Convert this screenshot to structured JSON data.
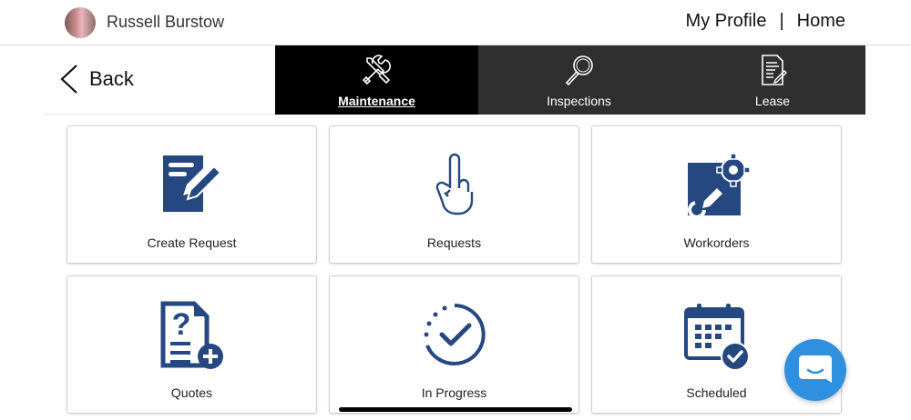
{
  "header": {
    "user_name": "Russell Burstow",
    "my_profile_label": "My Profile",
    "separator": "|",
    "home_label": "Home"
  },
  "back": {
    "label": "Back"
  },
  "tabs": [
    {
      "label": "Maintenance",
      "icon": "tools-icon",
      "active": true
    },
    {
      "label": "Inspections",
      "icon": "magnifier-icon",
      "active": false
    },
    {
      "label": "Lease",
      "icon": "document-edit-icon",
      "active": false
    }
  ],
  "tiles": [
    {
      "label": "Create Request",
      "icon": "create-request-icon"
    },
    {
      "label": "Requests",
      "icon": "raised-finger-icon"
    },
    {
      "label": "Workorders",
      "icon": "workorder-gear-icon"
    },
    {
      "label": "Quotes",
      "icon": "quote-add-icon"
    },
    {
      "label": "In Progress",
      "icon": "progress-check-icon"
    },
    {
      "label": "Scheduled",
      "icon": "calendar-check-icon"
    }
  ],
  "colors": {
    "icon_blue": "#24487f",
    "tab_bg": "#2f2f2f",
    "tab_active_bg": "#000000",
    "chat_blue": "#2f90df"
  }
}
